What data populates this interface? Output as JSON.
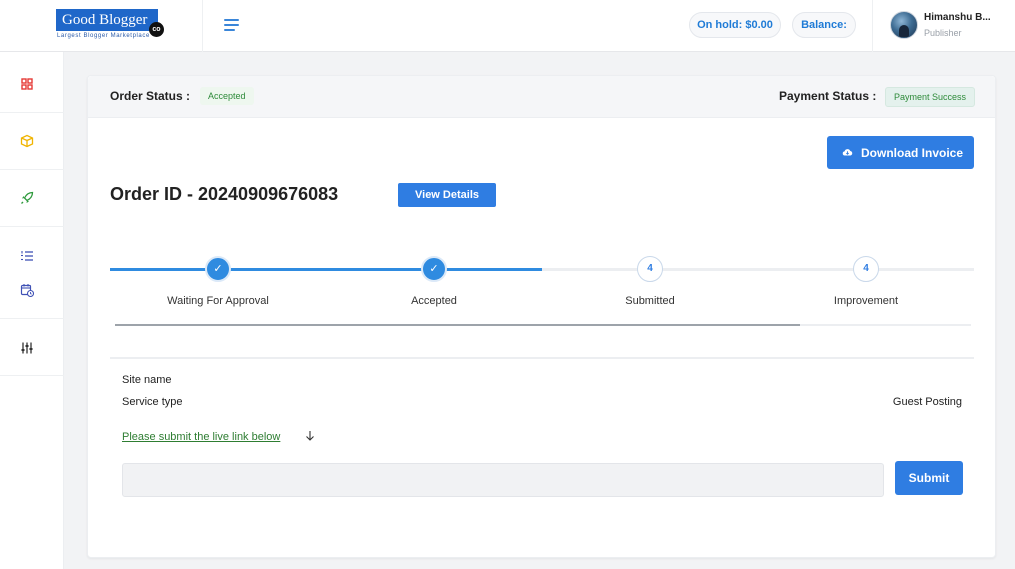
{
  "brand": {
    "name": "Good Blogger",
    "suffix": "co",
    "tagline": "Largest Blogger Marketplace"
  },
  "header": {
    "on_hold": "On hold: $0.00",
    "balance": "Balance:",
    "user_name": "Himanshu B...",
    "user_role": "Publisher"
  },
  "sidebar": {
    "items": [
      {
        "icon": "dashboard-grid-icon",
        "color": "#e53935"
      },
      {
        "icon": "package-box-icon",
        "color": "#f0b400"
      },
      {
        "icon": "rocket-icon",
        "color": "#2e9a3c"
      },
      {
        "icon": "ordered-list-icon",
        "color": "#3f51b5"
      },
      {
        "icon": "calendar-clock-icon",
        "color": "#3f51b5"
      },
      {
        "icon": "sliders-icon",
        "color": "#333333"
      }
    ]
  },
  "order": {
    "status_label": "Order Status :",
    "status_value": "Accepted",
    "payment_label": "Payment Status :",
    "payment_value": "Payment Success",
    "download_label": "Download Invoice",
    "id_text": "Order ID - 20240909676083",
    "view_details": "View Details"
  },
  "stepper": {
    "progress": 0.8,
    "steps": [
      {
        "label": "Waiting For Approval",
        "done": true,
        "mark": "✓"
      },
      {
        "label": "Accepted",
        "done": true,
        "mark": "✓"
      },
      {
        "label": "Submitted",
        "done": false,
        "mark": "4"
      },
      {
        "label": "Improvement",
        "done": false,
        "mark": "4"
      }
    ]
  },
  "details": {
    "site_name_label": "Site name",
    "site_name_value": "",
    "service_type_label": "Service type",
    "service_type_value": "Guest Posting",
    "live_link_prompt": "Please submit the live link below",
    "live_link_value": "",
    "live_link_placeholder": "",
    "submit_label": "Submit"
  },
  "colors": {
    "primary": "#2f7de2",
    "success": "#2e8b3a",
    "step_active": "#2f8be0"
  }
}
